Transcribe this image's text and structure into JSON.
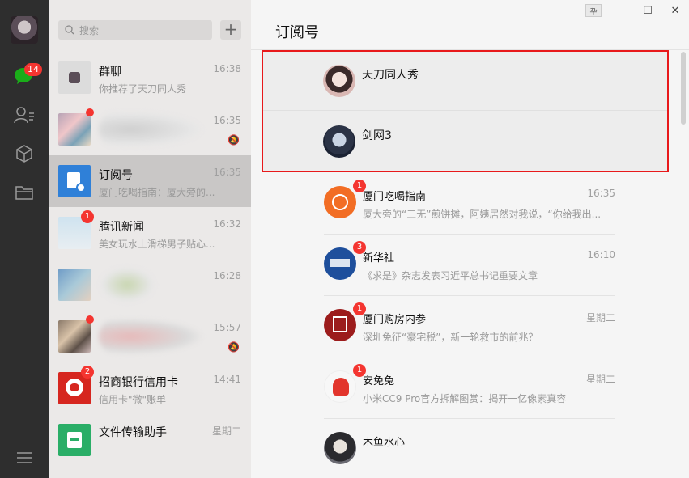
{
  "sidebar": {
    "unread_badge": "14",
    "icons": [
      "avatar",
      "chat-icon",
      "contacts-icon",
      "apps-cube-icon",
      "folder-icon",
      "menu-icon"
    ]
  },
  "search": {
    "placeholder": "搜索",
    "add_label": "+"
  },
  "chats": [
    {
      "name": "群聊",
      "time": "16:38",
      "preview": "你推荐了天刀同人秀"
    },
    {
      "name": "",
      "time": "16:35",
      "preview": "",
      "muted": true,
      "dot": true
    },
    {
      "name": "订阅号",
      "time": "16:35",
      "preview": "厦门吃喝指南：厦大旁的...",
      "selected": true
    },
    {
      "name": "腾讯新闻",
      "time": "16:32",
      "preview": "美女玩水上滑梯男子贴心...",
      "count": "1"
    },
    {
      "name": "",
      "time": "16:28",
      "preview": ""
    },
    {
      "name": "",
      "time": "15:57",
      "preview": "",
      "muted": true,
      "dot": true
    },
    {
      "name": "招商银行信用卡",
      "time": "14:41",
      "preview": "信用卡\"微\"账单",
      "count": "2"
    },
    {
      "name": "文件传输助手",
      "time": "星期二",
      "preview": ""
    }
  ],
  "main": {
    "title": "订阅号",
    "window_buttons": {
      "pin": "卆",
      "minimize": "—",
      "maximize": "☐",
      "close": "✕"
    },
    "featured": [
      {
        "name": "天刀同人秀"
      },
      {
        "name": "剑网3"
      }
    ],
    "accounts": [
      {
        "name": "厦门吃喝指南",
        "time": "16:35",
        "count": "1",
        "preview": "厦大旁的“三无”煎饼摊，阿姨居然对我说，“你给我出..."
      },
      {
        "name": "新华社",
        "time": "16:10",
        "count": "3",
        "preview": "《求是》杂志发表习近平总书记重要文章"
      },
      {
        "name": "厦门购房内参",
        "time": "星期二",
        "count": "1",
        "preview": "深圳免征“豪宅税”，新一轮救市的前兆？"
      },
      {
        "name": "安兔兔",
        "time": "星期二",
        "count": "1",
        "preview": "小米CC9 Pro官方拆解图赏：揭开一亿像素真容"
      },
      {
        "name": "木鱼水心",
        "time": "",
        "count": "",
        "preview": ""
      }
    ]
  },
  "colors": {
    "badge": "#f43530",
    "highlight_box": "#e8191b",
    "rail": "#2e2e2e",
    "list_bg": "#ebe9e8"
  }
}
